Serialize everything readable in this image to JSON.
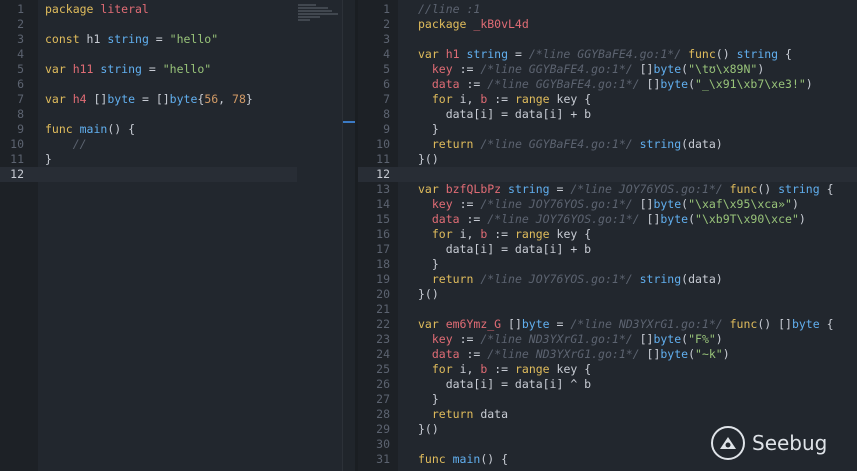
{
  "left_editor": {
    "lines": [
      {
        "n": "1",
        "tokens": [
          [
            "kw",
            "package "
          ],
          [
            "ident",
            "literal"
          ]
        ]
      },
      {
        "n": "2",
        "tokens": []
      },
      {
        "n": "3",
        "tokens": [
          [
            "kw",
            "const "
          ],
          [
            "op",
            "h1 "
          ],
          [
            "type",
            "string"
          ],
          [
            "op",
            " = "
          ],
          [
            "str",
            "\"hello\""
          ]
        ]
      },
      {
        "n": "4",
        "tokens": []
      },
      {
        "n": "5",
        "tokens": [
          [
            "kw",
            "var "
          ],
          [
            "ident",
            "h11 "
          ],
          [
            "type",
            "string"
          ],
          [
            "op",
            " = "
          ],
          [
            "str",
            "\"hello\""
          ]
        ]
      },
      {
        "n": "6",
        "tokens": []
      },
      {
        "n": "7",
        "tokens": [
          [
            "kw",
            "var "
          ],
          [
            "ident",
            "h4 "
          ],
          [
            "op",
            "[]"
          ],
          [
            "type",
            "byte"
          ],
          [
            "op",
            " = []"
          ],
          [
            "type",
            "byte"
          ],
          [
            "op",
            "{"
          ],
          [
            "num",
            "56"
          ],
          [
            "op",
            ", "
          ],
          [
            "num",
            "78"
          ],
          [
            "op",
            "}"
          ]
        ]
      },
      {
        "n": "8",
        "tokens": []
      },
      {
        "n": "9",
        "tokens": [
          [
            "kw",
            "func "
          ],
          [
            "type",
            "main"
          ],
          [
            "op",
            "() {"
          ]
        ]
      },
      {
        "n": "10",
        "tokens": [
          [
            "cmt",
            "    //"
          ]
        ]
      },
      {
        "n": "11",
        "tokens": [
          [
            "op",
            "}"
          ]
        ]
      },
      {
        "n": "12",
        "tokens": [],
        "active": true
      }
    ]
  },
  "right_editor": {
    "lines": [
      {
        "n": "1",
        "tokens": [
          [
            "cmt",
            "//line :1"
          ]
        ]
      },
      {
        "n": "2",
        "tokens": [
          [
            "kw",
            "package "
          ],
          [
            "ident",
            "_kB0vL4d"
          ]
        ]
      },
      {
        "n": "3",
        "tokens": []
      },
      {
        "n": "4",
        "tokens": [
          [
            "kw",
            "var "
          ],
          [
            "ident",
            "h1 "
          ],
          [
            "type",
            "string"
          ],
          [
            "op",
            " = "
          ],
          [
            "cmt",
            "/*line GGYBaFE4.go:1*/"
          ],
          [
            "op",
            " "
          ],
          [
            "kw",
            "func"
          ],
          [
            "op",
            "() "
          ],
          [
            "type",
            "string"
          ],
          [
            "op",
            " {"
          ]
        ]
      },
      {
        "n": "5",
        "tokens": [
          [
            "op",
            "  "
          ],
          [
            "ident",
            "key"
          ],
          [
            "op",
            " := "
          ],
          [
            "cmt",
            "/*line GGYBaFE4.go:1*/"
          ],
          [
            "op",
            " []"
          ],
          [
            "type",
            "byte"
          ],
          [
            "op",
            "("
          ],
          [
            "str",
            "\"\\tʊ\\x89N\""
          ],
          [
            "op",
            ")"
          ]
        ]
      },
      {
        "n": "6",
        "tokens": [
          [
            "op",
            "  "
          ],
          [
            "ident",
            "data"
          ],
          [
            "op",
            " := "
          ],
          [
            "cmt",
            "/*line GGYBaFE4.go:1*/"
          ],
          [
            "op",
            " []"
          ],
          [
            "type",
            "byte"
          ],
          [
            "op",
            "("
          ],
          [
            "str",
            "\"_\\x91\\xb7\\xe3!\""
          ],
          [
            "op",
            ")"
          ]
        ]
      },
      {
        "n": "7",
        "tokens": [
          [
            "op",
            "  "
          ],
          [
            "kw",
            "for"
          ],
          [
            "op",
            " i, "
          ],
          [
            "ident",
            "b"
          ],
          [
            "op",
            " := "
          ],
          [
            "kw",
            "range"
          ],
          [
            "op",
            " key {"
          ]
        ]
      },
      {
        "n": "8",
        "tokens": [
          [
            "op",
            "    data[i] = data[i] + b"
          ]
        ]
      },
      {
        "n": "9",
        "tokens": [
          [
            "op",
            "  }"
          ]
        ]
      },
      {
        "n": "10",
        "tokens": [
          [
            "op",
            "  "
          ],
          [
            "kw",
            "return"
          ],
          [
            "op",
            " "
          ],
          [
            "cmt",
            "/*line GGYBaFE4.go:1*/"
          ],
          [
            "op",
            " "
          ],
          [
            "type",
            "string"
          ],
          [
            "op",
            "(data)"
          ]
        ]
      },
      {
        "n": "11",
        "tokens": [
          [
            "op",
            "}()"
          ]
        ]
      },
      {
        "n": "12",
        "tokens": [],
        "active": true
      },
      {
        "n": "13",
        "tokens": [
          [
            "kw",
            "var "
          ],
          [
            "ident",
            "bzfQLbPz "
          ],
          [
            "type",
            "string"
          ],
          [
            "op",
            " = "
          ],
          [
            "cmt",
            "/*line JOY76YOS.go:1*/"
          ],
          [
            "op",
            " "
          ],
          [
            "kw",
            "func"
          ],
          [
            "op",
            "() "
          ],
          [
            "type",
            "string"
          ],
          [
            "op",
            " {"
          ]
        ]
      },
      {
        "n": "14",
        "tokens": [
          [
            "op",
            "  "
          ],
          [
            "ident",
            "key"
          ],
          [
            "op",
            " := "
          ],
          [
            "cmt",
            "/*line JOY76YOS.go:1*/"
          ],
          [
            "op",
            " []"
          ],
          [
            "type",
            "byte"
          ],
          [
            "op",
            "("
          ],
          [
            "str",
            "\"\\xaf\\x95\\xca»\""
          ],
          [
            "op",
            ")"
          ]
        ]
      },
      {
        "n": "15",
        "tokens": [
          [
            "op",
            "  "
          ],
          [
            "ident",
            "data"
          ],
          [
            "op",
            " := "
          ],
          [
            "cmt",
            "/*line JOY76YOS.go:1*/"
          ],
          [
            "op",
            " []"
          ],
          [
            "type",
            "byte"
          ],
          [
            "op",
            "("
          ],
          [
            "str",
            "\"\\xb9T\\x90\\xce\""
          ],
          [
            "op",
            ")"
          ]
        ]
      },
      {
        "n": "16",
        "tokens": [
          [
            "op",
            "  "
          ],
          [
            "kw",
            "for"
          ],
          [
            "op",
            " i, "
          ],
          [
            "ident",
            "b"
          ],
          [
            "op",
            " := "
          ],
          [
            "kw",
            "range"
          ],
          [
            "op",
            " key {"
          ]
        ]
      },
      {
        "n": "17",
        "tokens": [
          [
            "op",
            "    data[i] = data[i] + b"
          ]
        ]
      },
      {
        "n": "18",
        "tokens": [
          [
            "op",
            "  }"
          ]
        ]
      },
      {
        "n": "19",
        "tokens": [
          [
            "op",
            "  "
          ],
          [
            "kw",
            "return"
          ],
          [
            "op",
            " "
          ],
          [
            "cmt",
            "/*line JOY76YOS.go:1*/"
          ],
          [
            "op",
            " "
          ],
          [
            "type",
            "string"
          ],
          [
            "op",
            "(data)"
          ]
        ]
      },
      {
        "n": "20",
        "tokens": [
          [
            "op",
            "}()"
          ]
        ]
      },
      {
        "n": "21",
        "tokens": []
      },
      {
        "n": "22",
        "tokens": [
          [
            "kw",
            "var "
          ],
          [
            "ident",
            "em6Ymz_G "
          ],
          [
            "op",
            "[]"
          ],
          [
            "type",
            "byte"
          ],
          [
            "op",
            " = "
          ],
          [
            "cmt",
            "/*line ND3YXrG1.go:1*/"
          ],
          [
            "op",
            " "
          ],
          [
            "kw",
            "func"
          ],
          [
            "op",
            "() []"
          ],
          [
            "type",
            "byte"
          ],
          [
            "op",
            " {"
          ]
        ]
      },
      {
        "n": "23",
        "tokens": [
          [
            "op",
            "  "
          ],
          [
            "ident",
            "key"
          ],
          [
            "op",
            " := "
          ],
          [
            "cmt",
            "/*line ND3YXrG1.go:1*/"
          ],
          [
            "op",
            " []"
          ],
          [
            "type",
            "byte"
          ],
          [
            "op",
            "("
          ],
          [
            "str",
            "\"F%\""
          ],
          [
            "op",
            ")"
          ]
        ]
      },
      {
        "n": "24",
        "tokens": [
          [
            "op",
            "  "
          ],
          [
            "ident",
            "data"
          ],
          [
            "op",
            " := "
          ],
          [
            "cmt",
            "/*line ND3YXrG1.go:1*/"
          ],
          [
            "op",
            " []"
          ],
          [
            "type",
            "byte"
          ],
          [
            "op",
            "("
          ],
          [
            "str",
            "\"~k\""
          ],
          [
            "op",
            ")"
          ]
        ]
      },
      {
        "n": "25",
        "tokens": [
          [
            "op",
            "  "
          ],
          [
            "kw",
            "for"
          ],
          [
            "op",
            " i, "
          ],
          [
            "ident",
            "b"
          ],
          [
            "op",
            " := "
          ],
          [
            "kw",
            "range"
          ],
          [
            "op",
            " key {"
          ]
        ]
      },
      {
        "n": "26",
        "tokens": [
          [
            "op",
            "    data[i] = data[i] ^ b"
          ]
        ]
      },
      {
        "n": "27",
        "tokens": [
          [
            "op",
            "  }"
          ]
        ]
      },
      {
        "n": "28",
        "tokens": [
          [
            "op",
            "  "
          ],
          [
            "kw",
            "return"
          ],
          [
            "op",
            " data"
          ]
        ]
      },
      {
        "n": "29",
        "tokens": [
          [
            "op",
            "}()"
          ]
        ]
      },
      {
        "n": "30",
        "tokens": []
      },
      {
        "n": "31",
        "tokens": [
          [
            "kw",
            "func "
          ],
          [
            "type",
            "main"
          ],
          [
            "op",
            "() {"
          ]
        ]
      }
    ]
  },
  "watermark": {
    "text": "Seebug",
    "icon": "seebug-logo-icon"
  },
  "colors": {
    "background": "#22272e",
    "keyword": "#e0bc5c",
    "type": "#61afef",
    "identifier": "#e06c75",
    "string": "#98c379",
    "number": "#d19a66",
    "comment": "#5c6370",
    "scroll_marker": "#3b7ac4"
  }
}
